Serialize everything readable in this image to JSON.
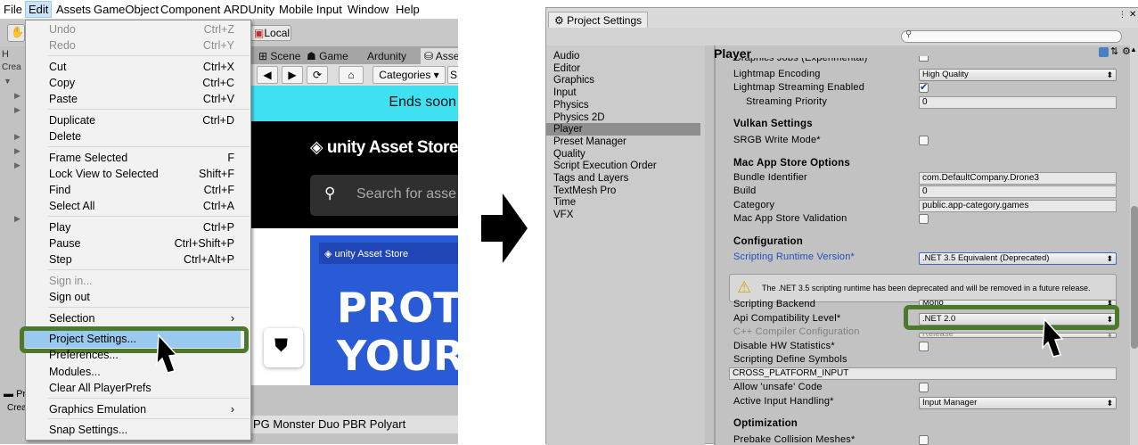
{
  "left": {
    "menubar": [
      "File",
      "Edit",
      "Assets",
      "GameObject",
      "Component",
      "ARDUnity",
      "Mobile Input",
      "Window",
      "Help"
    ],
    "toolbar": {
      "local": "Local"
    },
    "hierarchy_tab": "H",
    "create": "Crea",
    "tabs": [
      "Scene",
      "Game",
      "Ardunity",
      "Asse"
    ],
    "nav": {
      "categories": "Categories ▾",
      "s": "S"
    },
    "banner": "Ends soon",
    "store_logo": "unity Asset Store",
    "search_placeholder": "Search for asse",
    "promo_logo": "unity Asset Store",
    "promo_line1": "PROT",
    "promo_line2": "YOUR",
    "bottom_tab": "Pr",
    "bottom_create": "Crea",
    "package": "PG Monster Duo PBR Polyart"
  },
  "menu": [
    {
      "label": "Undo",
      "shortcut": "Ctrl+Z",
      "disabled": true
    },
    {
      "label": "Redo",
      "shortcut": "Ctrl+Y",
      "disabled": true
    },
    {
      "label": "Cut",
      "shortcut": "Ctrl+X"
    },
    {
      "label": "Copy",
      "shortcut": "Ctrl+C"
    },
    {
      "label": "Paste",
      "shortcut": "Ctrl+V"
    },
    {
      "label": "Duplicate",
      "shortcut": "Ctrl+D"
    },
    {
      "label": "Delete",
      "shortcut": ""
    },
    {
      "label": "Frame Selected",
      "shortcut": "F"
    },
    {
      "label": "Lock View to Selected",
      "shortcut": "Shift+F"
    },
    {
      "label": "Find",
      "shortcut": "Ctrl+F"
    },
    {
      "label": "Select All",
      "shortcut": "Ctrl+A"
    },
    {
      "label": "Play",
      "shortcut": "Ctrl+P"
    },
    {
      "label": "Pause",
      "shortcut": "Ctrl+Shift+P"
    },
    {
      "label": "Step",
      "shortcut": "Ctrl+Alt+P"
    },
    {
      "label": "Sign in...",
      "shortcut": "",
      "disabled": true
    },
    {
      "label": "Sign out",
      "shortcut": ""
    },
    {
      "label": "Selection",
      "shortcut": "›"
    },
    {
      "label": "Project Settings...",
      "shortcut": ""
    },
    {
      "label": "Preferences...",
      "shortcut": ""
    },
    {
      "label": "Modules...",
      "shortcut": ""
    },
    {
      "label": "Clear All PlayerPrefs",
      "shortcut": ""
    },
    {
      "label": "Graphics Emulation",
      "shortcut": "›"
    },
    {
      "label": "Snap Settings...",
      "shortcut": ""
    }
  ],
  "right": {
    "window_title": "Project Settings",
    "list": [
      "Audio",
      "Editor",
      "Graphics",
      "Input",
      "Physics",
      "Physics 2D",
      "Player",
      "Preset Manager",
      "Quality",
      "Script Execution Order",
      "Tags and Layers",
      "TextMesh Pro",
      "Time",
      "VFX"
    ],
    "selected": "Player",
    "header": "Player",
    "rows": {
      "clipped": "Graphics Jobs (Experimental)",
      "lightmap_encoding": "Lightmap Encoding",
      "lightmap_encoding_val": "High Quality",
      "lightmap_streaming": "Lightmap Streaming Enabled",
      "streaming_priority": "Streaming Priority",
      "streaming_priority_val": "0",
      "vulkan": "Vulkan Settings",
      "srgb": "SRGB Write Mode*",
      "mac": "Mac App Store Options",
      "bundle_id": "Bundle Identifier",
      "bundle_id_val": "com.DefaultCompany.Drone3",
      "build": "Build",
      "build_val": "0",
      "category": "Category",
      "category_val": "public.app-category.games",
      "mac_validation": "Mac App Store Validation",
      "config": "Configuration",
      "runtime": "Scripting Runtime Version*",
      "runtime_val": ".NET 3.5 Equivalent (Deprecated)",
      "warning": "The .NET 3.5 scripting runtime has been deprecated and will be removed in a future release.",
      "backend": "Scripting Backend",
      "backend_val": "Mono",
      "api": "Api Compatibility Level*",
      "api_val": ".NET 2.0",
      "cpp": "C++ Compiler Configuration",
      "cpp_val": "Release",
      "hw": "Disable HW Statistics*",
      "define": "Scripting Define Symbols",
      "define_val": "CROSS_PLATFORM_INPUT",
      "unsafe": "Allow 'unsafe' Code",
      "input": "Active Input Handling*",
      "input_val": "Input Manager",
      "optimization": "Optimization",
      "prebake": "Prebake Collision Meshes*"
    }
  },
  "colors": {
    "highlight_outline": "#4d7a2a",
    "menu_selection": "#99c9ef",
    "store_cyan": "#3fe0f2",
    "promo_blue": "#2a5bd7"
  }
}
